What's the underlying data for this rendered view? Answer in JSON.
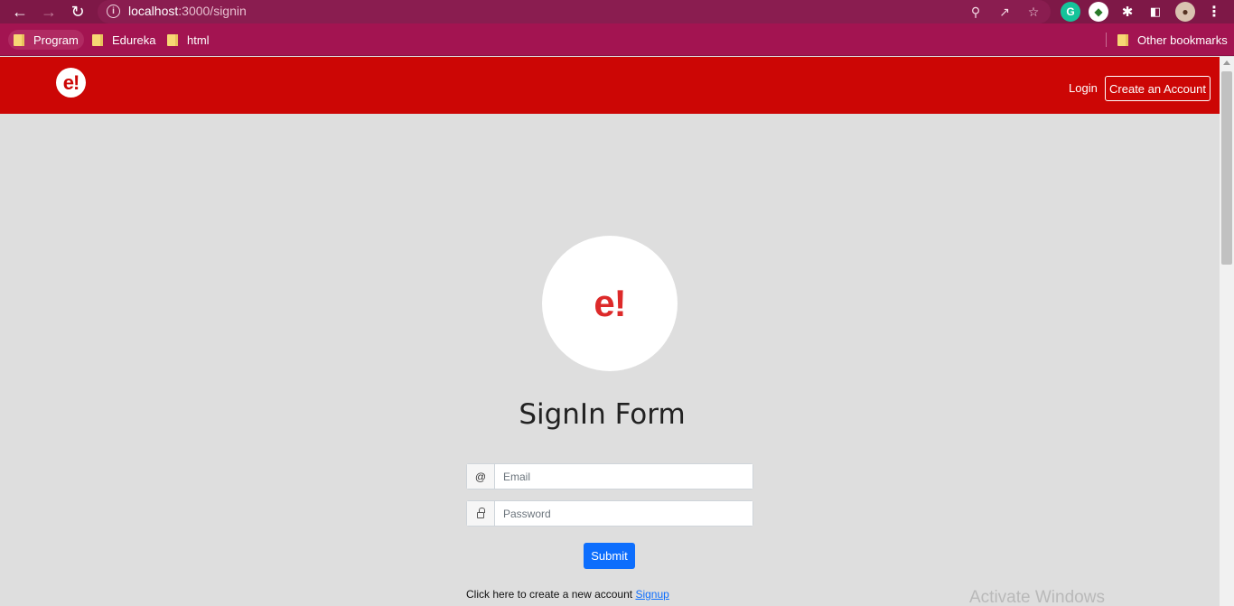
{
  "browser": {
    "url_host": "localhost",
    "url_path": ":3000/signin",
    "bookmarks": [
      "Program",
      "Edureka",
      "html"
    ],
    "other_bookmarks": "Other bookmarks"
  },
  "navbar": {
    "logo_text": "e!",
    "login_label": "Login",
    "create_account_label": "Create an Account"
  },
  "main": {
    "logo_text": "e!",
    "title": "SignIn Form",
    "email_addon": "@",
    "email_placeholder": "Email",
    "password_placeholder": "Password",
    "submit_label": "Submit",
    "signup_prompt": "Click here to create a new account",
    "signup_link": "Signup"
  },
  "overlay": {
    "activate_windows": "Activate Windows"
  },
  "colors": {
    "navbar": "#cc0605",
    "browser_frame": "#7e1847",
    "bookmark_bar": "#a31451",
    "primary_button": "#0d6efd",
    "page_background": "#dedede"
  }
}
